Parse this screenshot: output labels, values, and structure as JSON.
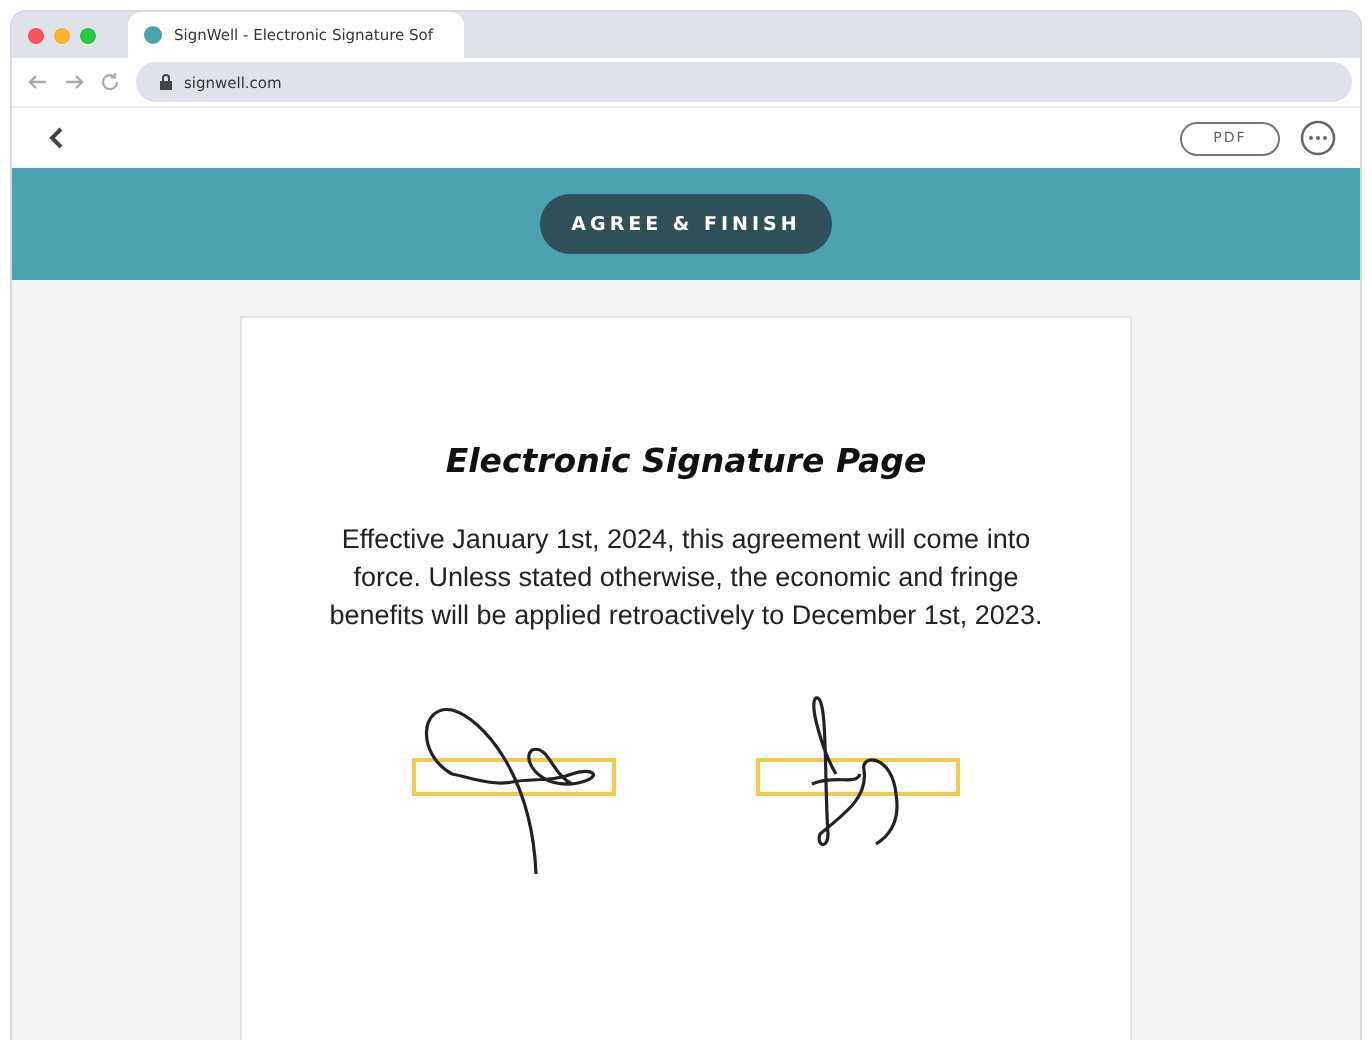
{
  "browser": {
    "tab_title": "SignWell - Electronic Signature Sof",
    "url": "signwell.com"
  },
  "toolbar": {
    "pdf_button": "PDF"
  },
  "banner": {
    "button": "AGREE & FINISH"
  },
  "document": {
    "title": "Electronic Signature Page",
    "body": "Effective January 1st, 2024, this agreement will come into force. Unless stated otherwise, the economic and fringe benefits will be applied retroactively to December 1st, 2023."
  }
}
